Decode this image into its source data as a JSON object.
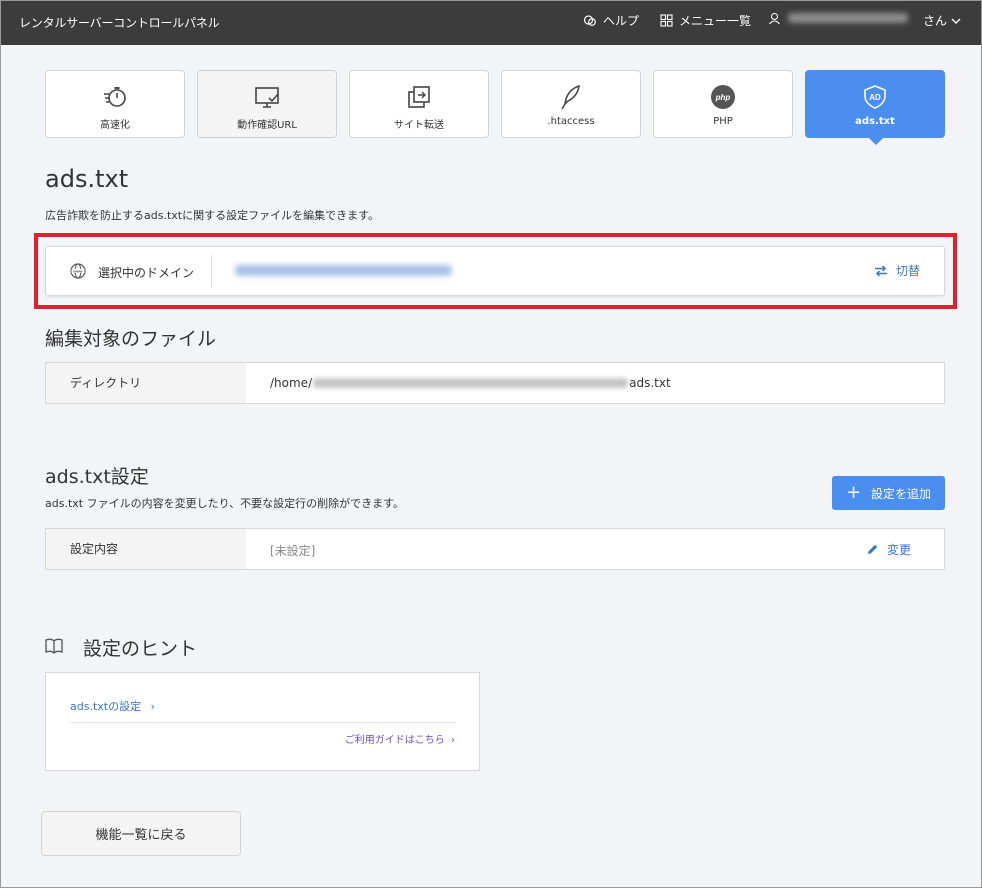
{
  "header": {
    "title": "レンタルサーバーコントロールパネル",
    "help": "ヘルプ",
    "menu": "メニュー一覧",
    "user_suffix": "さん"
  },
  "tabs": [
    {
      "label": "高速化",
      "icon": "speed-icon"
    },
    {
      "label": "動作確認URL",
      "icon": "monitor-check-icon"
    },
    {
      "label": "サイト転送",
      "icon": "transfer-icon"
    },
    {
      "label": ".htaccess",
      "icon": "feather-icon"
    },
    {
      "label": "PHP",
      "icon": "php-icon",
      "icon_text": "php"
    },
    {
      "label": "ads.txt",
      "icon": "ad-shield-icon",
      "icon_text": "AD",
      "active": true
    }
  ],
  "page": {
    "title": "ads.txt",
    "description": "広告詐欺を防止するads.txtに関する設定ファイルを編集できます。"
  },
  "domain": {
    "label": "選択中のドメイン",
    "switch_label": "切替"
  },
  "file_section": {
    "title": "編集対象のファイル",
    "key": "ディレクトリ",
    "path_prefix": "/home/",
    "path_suffix": "ads.txt"
  },
  "settings": {
    "title": "ads.txt設定",
    "description": "ads.txt ファイルの内容を変更したり、不要な設定行の削除ができます。",
    "add_button": "設定を追加",
    "key": "設定内容",
    "value": "[未設定]",
    "edit_label": "変更"
  },
  "hints": {
    "title": "設定のヒント",
    "link": "ads.txtの設定",
    "guide": "ご利用ガイドはこちら"
  },
  "back_button": "機能一覧に戻る",
  "colors": {
    "accent": "#4a8ef0",
    "highlight": "#e0202e",
    "header": "#3c3c3c",
    "link": "#3a74c7"
  }
}
